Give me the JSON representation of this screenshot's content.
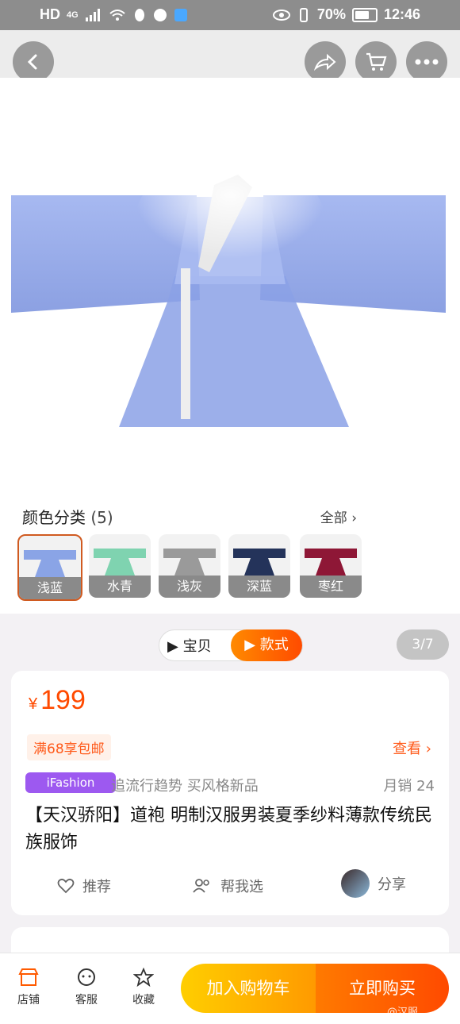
{
  "status": {
    "left_icons": [
      "hd-icon",
      "4g-icon",
      "signal-icon",
      "wifi-icon",
      "qq-icon",
      "app-icon",
      "app2-icon"
    ],
    "battery": "70%",
    "time": "12:46"
  },
  "nav": {
    "back": "back-icon",
    "share": "share-icon",
    "cart": "cart-icon",
    "more": "more-icon"
  },
  "colors": {
    "title": "颜色分类",
    "count": "(5)",
    "all": "全部",
    "items": [
      {
        "label": "浅蓝",
        "color": "#8aa4e6"
      },
      {
        "label": "水青",
        "color": "#7fd3b0"
      },
      {
        "label": "浅灰",
        "color": "#9a9a9a"
      },
      {
        "label": "深蓝",
        "color": "#24335a"
      },
      {
        "label": "枣红",
        "color": "#8e1736"
      }
    ]
  },
  "tabs": {
    "item": "宝贝",
    "style": "款式",
    "pager": "3/7"
  },
  "product": {
    "currency": "¥",
    "price": "199",
    "shipping": "满68享包邮",
    "view": "查看",
    "ifashion": "iFashion",
    "slogan": "追流行趋势 买风格新品",
    "sales_label": "月销",
    "sales_value": "24",
    "title": "【天汉骄阳】道袍 明制汉服男装夏季纱料薄款传统民族服饰",
    "actions": {
      "recommend": "推荐",
      "help": "帮我选",
      "share": "分享"
    }
  },
  "bottom": {
    "shop": "店铺",
    "service": "客服",
    "favorite": "收藏",
    "add_cart": "加入购物车",
    "buy_now": "立即购买",
    "watermark": "@汉服"
  }
}
